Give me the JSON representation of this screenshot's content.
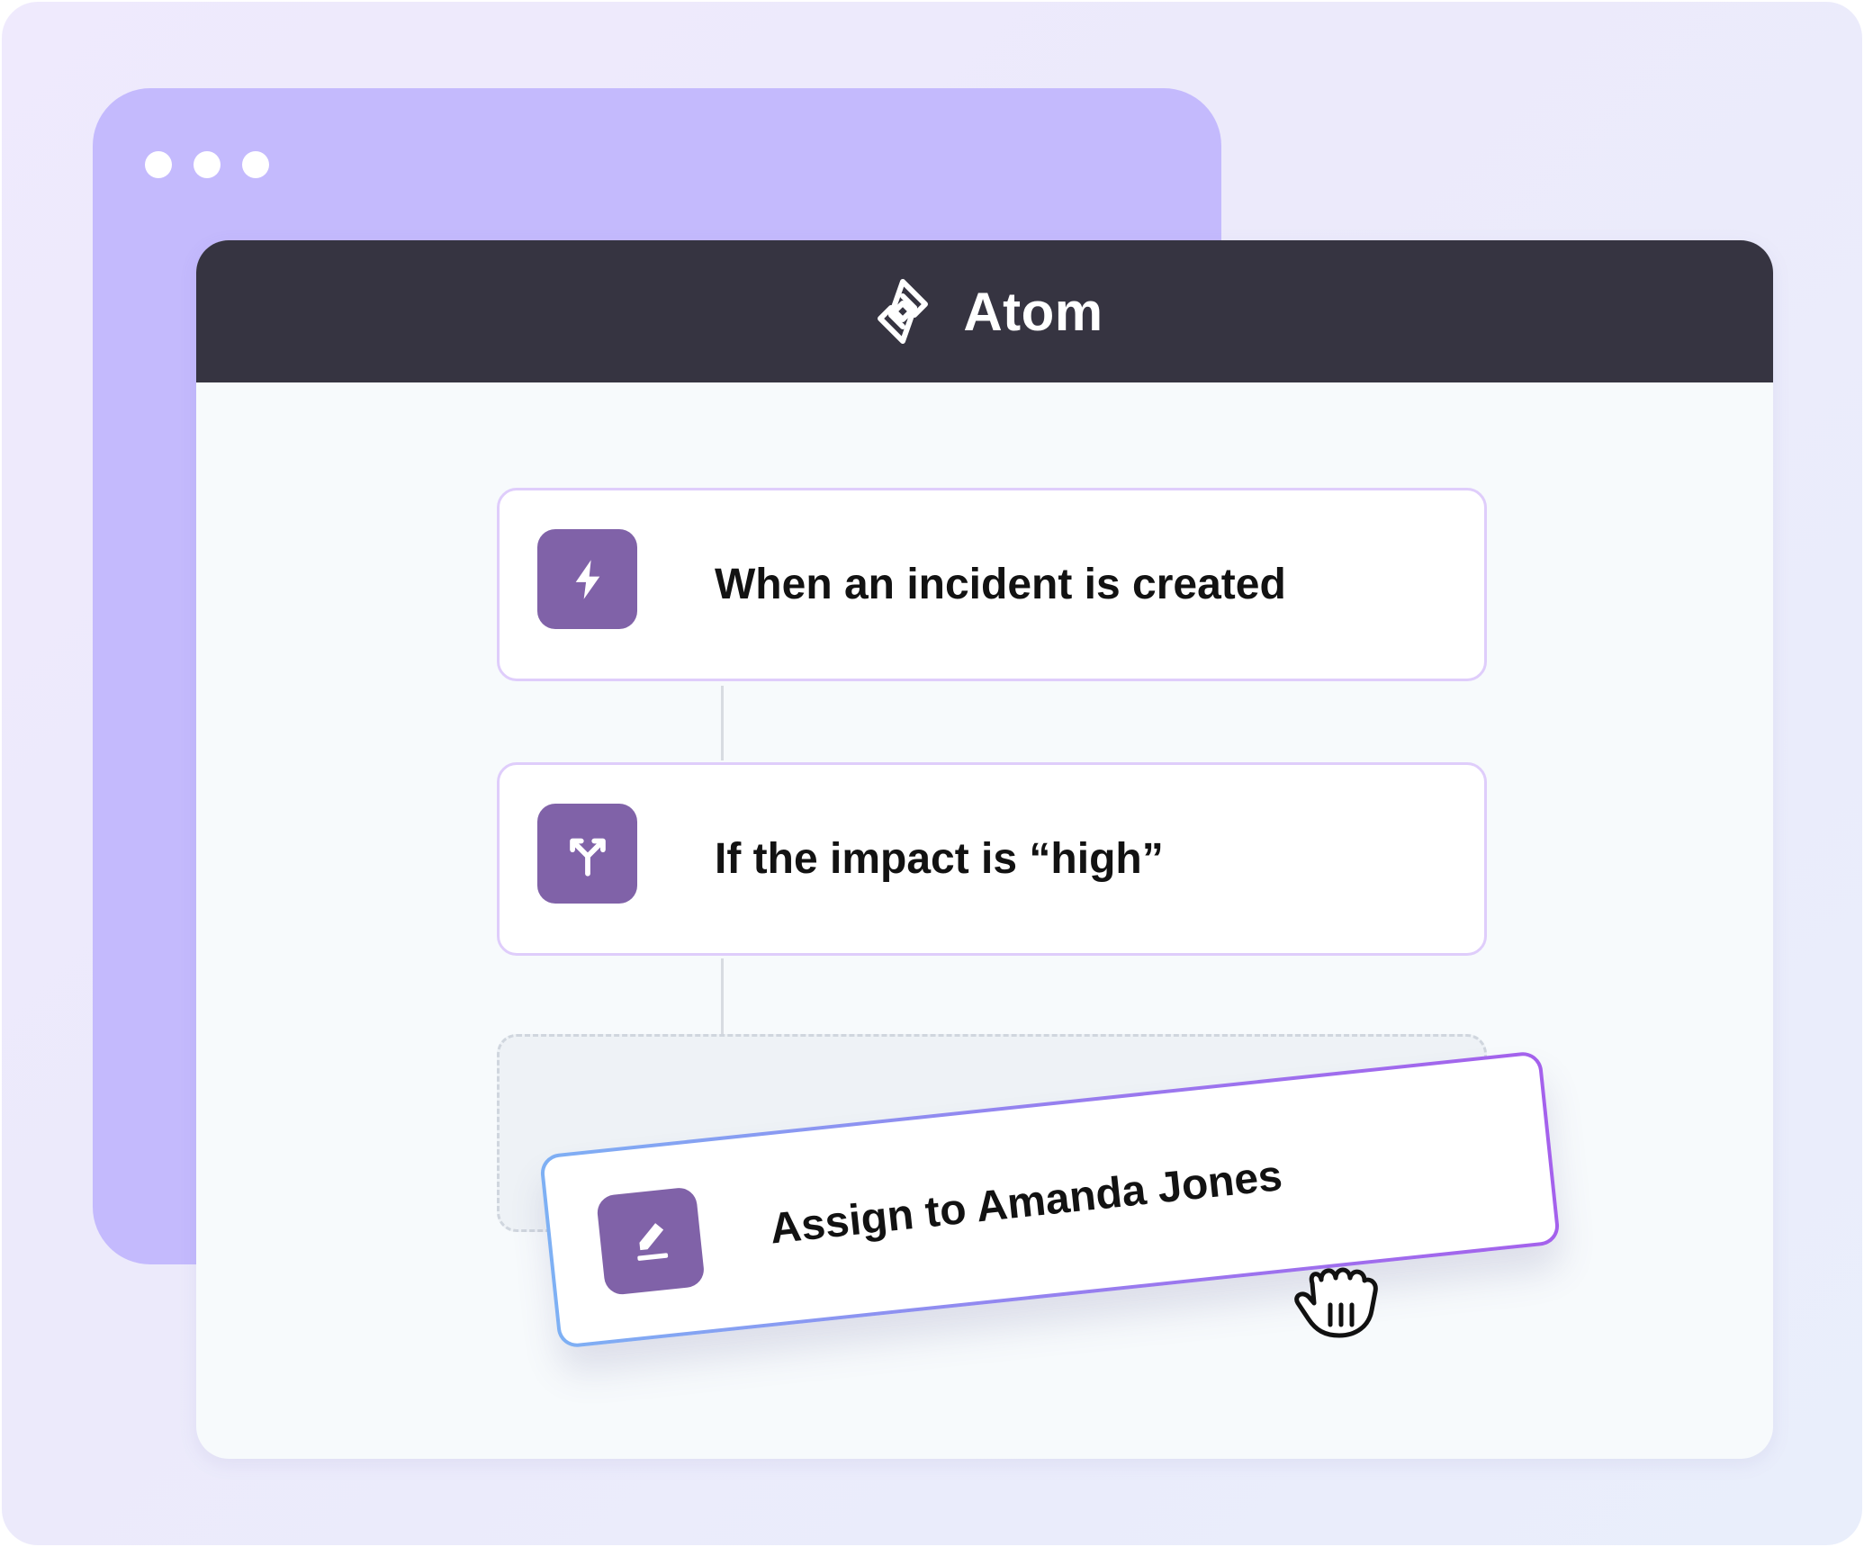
{
  "app": {
    "title": "Atom"
  },
  "workflow": {
    "steps": [
      {
        "label": "When an incident is created",
        "icon": "lightning-icon"
      },
      {
        "label": "If the impact is “high”",
        "icon": "branch-split-icon"
      }
    ],
    "dragging_step": {
      "label": "Assign to Amanda Jones",
      "icon": "pencil-edit-icon"
    }
  },
  "colors": {
    "titlebar": "#363441",
    "back_window": "#c4bafd",
    "step_icon_bg": "#8062a8",
    "card_border": "#dfcdfb",
    "drag_gradient_start": "#7eb0f4",
    "drag_gradient_end": "#a461ec"
  }
}
